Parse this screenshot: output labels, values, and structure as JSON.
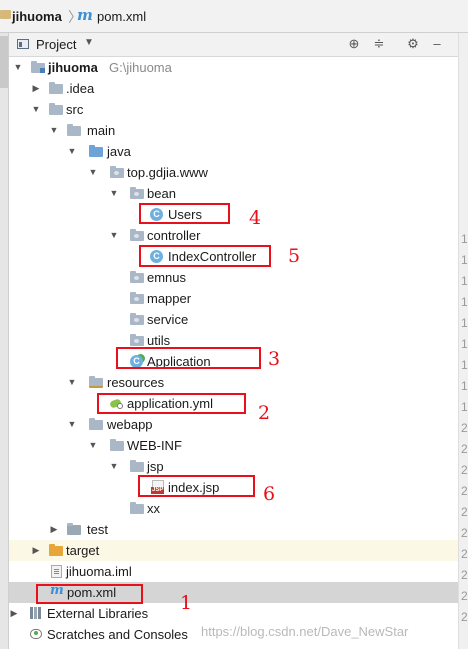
{
  "titlebar": {
    "project": "jihuoma",
    "separator": "〉",
    "file_icon": "m",
    "file": "pom.xml"
  },
  "project_panel": {
    "title": "Project",
    "dropdown_icon": "triangle-down",
    "buttons": [
      "crosshair-icon",
      "collapse-icon",
      "gear-icon",
      "minimize-icon"
    ]
  },
  "tree": {
    "root": {
      "name": "jihuoma",
      "path": "G:\\jihuoma"
    },
    "idea": ".idea",
    "src": "src",
    "main": "main",
    "java": "java",
    "package": "top.gdjia.www",
    "bean": "bean",
    "users": "Users",
    "controller": "controller",
    "index_controller": "IndexController",
    "emnus": "emnus",
    "mapper": "mapper",
    "service": "service",
    "utils": "utils",
    "application": "Application",
    "resources": "resources",
    "application_yml": "application.yml",
    "webapp": "webapp",
    "web_inf": "WEB-INF",
    "jsp": "jsp",
    "index_jsp": "index.jsp",
    "xx": "xx",
    "test": "test",
    "target": "target",
    "iml": "jihuoma.iml",
    "pom": "pom.xml",
    "external_libraries": "External Libraries",
    "scratches": "Scratches and Consoles",
    "class_icon_letter": "C"
  },
  "annotations": [
    "1",
    "2",
    "3",
    "4",
    "5",
    "6"
  ],
  "gutter": [
    "1",
    "1",
    "1",
    "1",
    "1",
    "1",
    "1",
    "1",
    "1",
    "2",
    "2",
    "2",
    "2",
    "2",
    "2",
    "2",
    "2",
    "2",
    "2"
  ],
  "watermark": "https://blog.csdn.net/Dave_NewStar",
  "colors": {
    "annotation": "#e8101a",
    "selection": "#d5d5d5",
    "source_folder": "#6fa3d8",
    "target_folder": "#e8a53a"
  }
}
